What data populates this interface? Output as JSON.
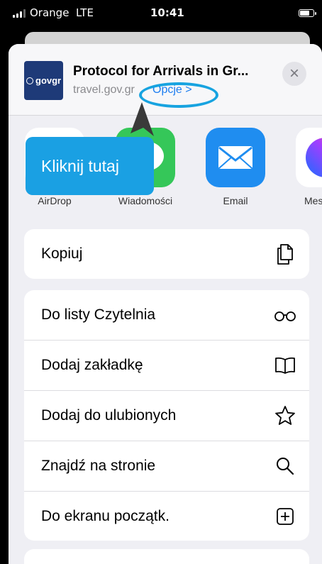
{
  "status_bar": {
    "carrier": "Orange",
    "network": "LTE",
    "time": "10:41"
  },
  "share_sheet": {
    "page_title": "Protocol for Arrivals in Gr...",
    "thumbnail_text": "govgr",
    "url": "travel.gov.gr",
    "options_label": "Opcje >",
    "close_label": "×",
    "apps": [
      {
        "label": "AirDrop",
        "icon": "airdrop-icon"
      },
      {
        "label": "Wiadomości",
        "icon": "messages-icon"
      },
      {
        "label": "Email",
        "icon": "mail-icon"
      },
      {
        "label": "Mess",
        "icon": "messenger-icon"
      }
    ],
    "copy_group": [
      {
        "label": "Kopiuj",
        "icon": "copy-icon"
      }
    ],
    "actions": [
      {
        "label": "Do listy Czytelnia",
        "icon": "glasses-icon"
      },
      {
        "label": "Dodaj zakładkę",
        "icon": "book-icon"
      },
      {
        "label": "Dodaj do ulubionych",
        "icon": "star-icon"
      },
      {
        "label": "Znajdź na stronie",
        "icon": "search-icon"
      },
      {
        "label": "Do ekranu początk.",
        "icon": "add-square-icon"
      }
    ]
  },
  "annotation": {
    "callout_text": "Kliknij tutaj"
  },
  "colors": {
    "accent_blue": "#1b7cf0",
    "callout_blue": "#1aa0e3",
    "sheet_background": "#efeff4"
  }
}
